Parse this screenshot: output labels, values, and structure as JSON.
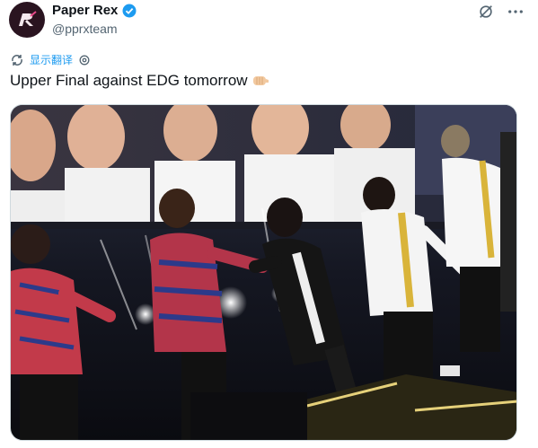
{
  "author": {
    "display_name": "Paper Rex",
    "handle": "@pprxteam",
    "verified_icon": "verified-badge-icon",
    "avatar_icon": "paper-rex-logo-icon"
  },
  "translate": {
    "label": "显示翻译"
  },
  "tweet": {
    "text": "Upper Final against EDG tomorrow"
  },
  "colors": {
    "accent": "#1d9bf0",
    "text": "#0f1419",
    "muted": "#536471"
  },
  "media": {
    "description_icon": "photo-icon"
  }
}
